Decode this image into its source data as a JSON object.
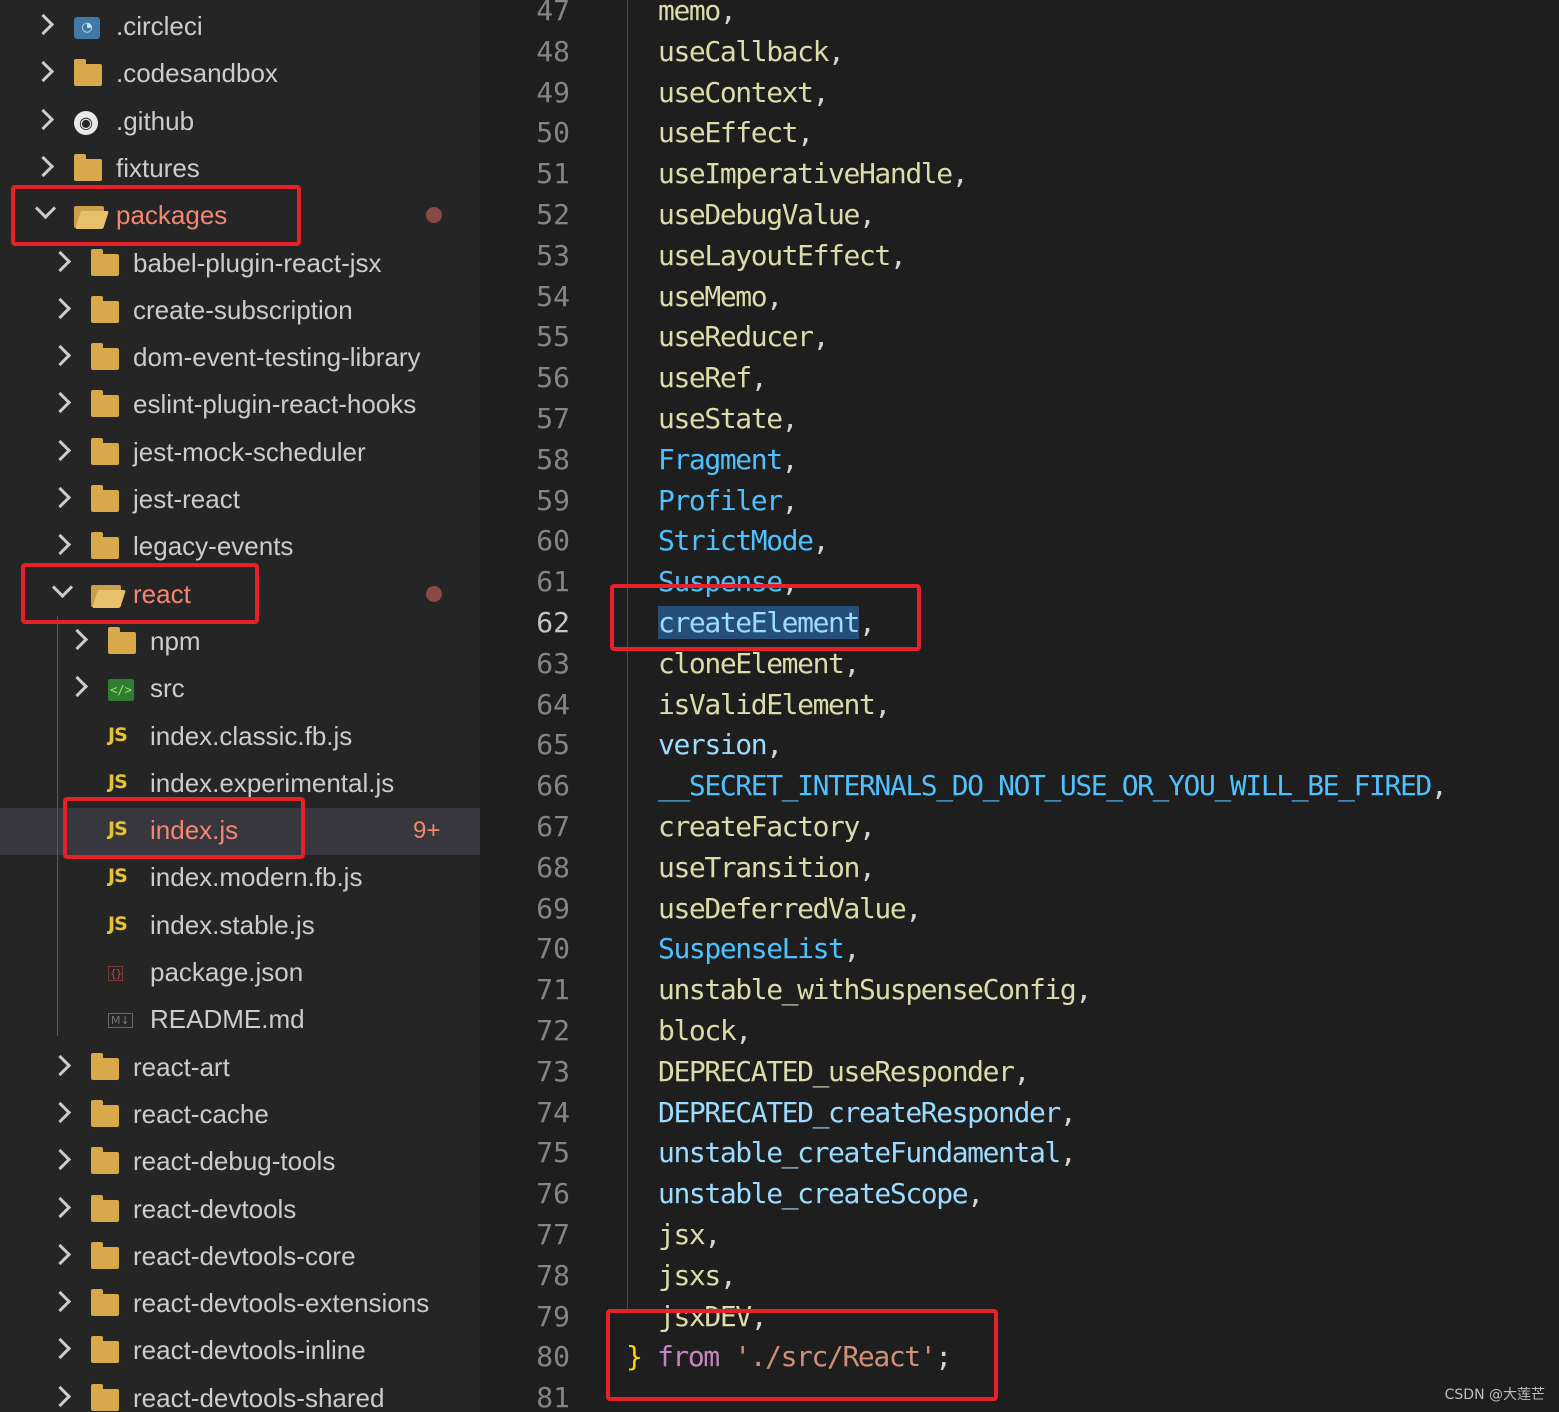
{
  "explorer": {
    "items": [
      {
        "label": ".circleci",
        "icon": "circleci-folder-icon",
        "expanded": false,
        "depth": 0
      },
      {
        "label": ".codesandbox",
        "icon": "folder-icon",
        "expanded": false,
        "depth": 0
      },
      {
        "label": ".github",
        "icon": "github-folder-icon",
        "expanded": false,
        "depth": 0
      },
      {
        "label": "fixtures",
        "icon": "folder-icon",
        "expanded": false,
        "depth": 0
      },
      {
        "label": "packages",
        "icon": "folder-open-icon",
        "expanded": true,
        "depth": 0,
        "modified": true
      },
      {
        "label": "babel-plugin-react-jsx",
        "icon": "folder-icon",
        "expanded": false,
        "depth": 1
      },
      {
        "label": "create-subscription",
        "icon": "folder-icon",
        "expanded": false,
        "depth": 1
      },
      {
        "label": "dom-event-testing-library",
        "icon": "folder-icon",
        "expanded": false,
        "depth": 1
      },
      {
        "label": "eslint-plugin-react-hooks",
        "icon": "folder-icon",
        "expanded": false,
        "depth": 1
      },
      {
        "label": "jest-mock-scheduler",
        "icon": "folder-icon",
        "expanded": false,
        "depth": 1
      },
      {
        "label": "jest-react",
        "icon": "folder-icon",
        "expanded": false,
        "depth": 1
      },
      {
        "label": "legacy-events",
        "icon": "folder-icon",
        "expanded": false,
        "depth": 1
      },
      {
        "label": "react",
        "icon": "folder-open-icon",
        "expanded": true,
        "depth": 1,
        "modified": true
      },
      {
        "label": "npm",
        "icon": "folder-icon",
        "expanded": false,
        "depth": 2
      },
      {
        "label": "src",
        "icon": "src-folder-icon",
        "expanded": false,
        "depth": 2
      },
      {
        "label": "index.classic.fb.js",
        "icon": "js-file-icon",
        "depth": 2
      },
      {
        "label": "index.experimental.js",
        "icon": "js-file-icon",
        "depth": 2
      },
      {
        "label": "index.js",
        "icon": "js-file-icon",
        "depth": 2,
        "selected": true,
        "badge": "9+"
      },
      {
        "label": "index.modern.fb.js",
        "icon": "js-file-icon",
        "depth": 2
      },
      {
        "label": "index.stable.js",
        "icon": "js-file-icon",
        "depth": 2
      },
      {
        "label": "package.json",
        "icon": "json-file-icon",
        "depth": 2
      },
      {
        "label": "README.md",
        "icon": "markdown-file-icon",
        "depth": 2
      },
      {
        "label": "react-art",
        "icon": "folder-icon",
        "expanded": false,
        "depth": 1
      },
      {
        "label": "react-cache",
        "icon": "folder-icon",
        "expanded": false,
        "depth": 1
      },
      {
        "label": "react-debug-tools",
        "icon": "folder-icon",
        "expanded": false,
        "depth": 1
      },
      {
        "label": "react-devtools",
        "icon": "folder-icon",
        "expanded": false,
        "depth": 1
      },
      {
        "label": "react-devtools-core",
        "icon": "folder-icon",
        "expanded": false,
        "depth": 1
      },
      {
        "label": "react-devtools-extensions",
        "icon": "folder-icon",
        "expanded": false,
        "depth": 1
      },
      {
        "label": "react-devtools-inline",
        "icon": "folder-icon",
        "expanded": false,
        "depth": 1
      },
      {
        "label": "react-devtools-shared",
        "icon": "folder-icon",
        "expanded": false,
        "depth": 1
      }
    ],
    "icon_glyphs": {
      "js": "JS",
      "json": "{}",
      "md": "M↓",
      "src": "</>",
      "circleci": "◔",
      "github": "◉"
    }
  },
  "editor": {
    "current_line": "62",
    "lines": [
      {
        "n": "47",
        "parts": [
          [
            "var",
            "memo"
          ],
          [
            "punc",
            ","
          ]
        ]
      },
      {
        "n": "48",
        "parts": [
          [
            "var",
            "useCallback"
          ],
          [
            "punc",
            ","
          ]
        ]
      },
      {
        "n": "49",
        "parts": [
          [
            "var",
            "useContext"
          ],
          [
            "punc",
            ","
          ]
        ]
      },
      {
        "n": "50",
        "parts": [
          [
            "var",
            "useEffect"
          ],
          [
            "punc",
            ","
          ]
        ]
      },
      {
        "n": "51",
        "parts": [
          [
            "var",
            "useImperativeHandle"
          ],
          [
            "punc",
            ","
          ]
        ]
      },
      {
        "n": "52",
        "parts": [
          [
            "var",
            "useDebugValue"
          ],
          [
            "punc",
            ","
          ]
        ]
      },
      {
        "n": "53",
        "parts": [
          [
            "var",
            "useLayoutEffect"
          ],
          [
            "punc",
            ","
          ]
        ]
      },
      {
        "n": "54",
        "parts": [
          [
            "var",
            "useMemo"
          ],
          [
            "punc",
            ","
          ]
        ]
      },
      {
        "n": "55",
        "parts": [
          [
            "var",
            "useReducer"
          ],
          [
            "punc",
            ","
          ]
        ]
      },
      {
        "n": "56",
        "parts": [
          [
            "var",
            "useRef"
          ],
          [
            "punc",
            ","
          ]
        ]
      },
      {
        "n": "57",
        "parts": [
          [
            "var",
            "useState"
          ],
          [
            "punc",
            ","
          ]
        ]
      },
      {
        "n": "58",
        "parts": [
          [
            "const",
            "Fragment"
          ],
          [
            "punc",
            ","
          ]
        ]
      },
      {
        "n": "59",
        "parts": [
          [
            "const",
            "Profiler"
          ],
          [
            "punc",
            ","
          ]
        ]
      },
      {
        "n": "60",
        "parts": [
          [
            "const",
            "StrictMode"
          ],
          [
            "punc",
            ","
          ]
        ]
      },
      {
        "n": "61",
        "parts": [
          [
            "const",
            "Suspense"
          ],
          [
            "punc",
            ","
          ]
        ]
      },
      {
        "n": "62",
        "parts": [
          [
            "sel",
            "createElement"
          ],
          [
            "punc",
            ","
          ]
        ]
      },
      {
        "n": "63",
        "parts": [
          [
            "var",
            "cloneElement"
          ],
          [
            "punc",
            ","
          ]
        ]
      },
      {
        "n": "64",
        "parts": [
          [
            "var",
            "isValidElement"
          ],
          [
            "punc",
            ","
          ]
        ]
      },
      {
        "n": "65",
        "parts": [
          [
            "light",
            "version"
          ],
          [
            "punc",
            ","
          ]
        ]
      },
      {
        "n": "66",
        "parts": [
          [
            "const",
            "__SECRET_INTERNALS_DO_NOT_USE_OR_YOU_WILL_BE_FIRED"
          ],
          [
            "punc",
            ","
          ]
        ]
      },
      {
        "n": "67",
        "parts": [
          [
            "var",
            "createFactory"
          ],
          [
            "punc",
            ","
          ]
        ]
      },
      {
        "n": "68",
        "parts": [
          [
            "var",
            "useTransition"
          ],
          [
            "punc",
            ","
          ]
        ]
      },
      {
        "n": "69",
        "parts": [
          [
            "var",
            "useDeferredValue"
          ],
          [
            "punc",
            ","
          ]
        ]
      },
      {
        "n": "70",
        "parts": [
          [
            "const",
            "SuspenseList"
          ],
          [
            "punc",
            ","
          ]
        ]
      },
      {
        "n": "71",
        "parts": [
          [
            "var",
            "unstable_withSuspenseConfig"
          ],
          [
            "punc",
            ","
          ]
        ]
      },
      {
        "n": "72",
        "parts": [
          [
            "var",
            "block"
          ],
          [
            "punc",
            ","
          ]
        ]
      },
      {
        "n": "73",
        "parts": [
          [
            "var",
            "DEPRECATED_useResponder"
          ],
          [
            "punc",
            ","
          ]
        ]
      },
      {
        "n": "74",
        "parts": [
          [
            "light",
            "DEPRECATED_createResponder"
          ],
          [
            "punc",
            ","
          ]
        ]
      },
      {
        "n": "75",
        "parts": [
          [
            "light",
            "unstable_createFundamental"
          ],
          [
            "punc",
            ","
          ]
        ]
      },
      {
        "n": "76",
        "parts": [
          [
            "light",
            "unstable_createScope"
          ],
          [
            "punc",
            ","
          ]
        ]
      },
      {
        "n": "77",
        "parts": [
          [
            "var",
            "jsx"
          ],
          [
            "punc",
            ","
          ]
        ]
      },
      {
        "n": "78",
        "parts": [
          [
            "var",
            "jsxs"
          ],
          [
            "punc",
            ","
          ]
        ]
      },
      {
        "n": "79",
        "parts": [
          [
            "var",
            "jsxDEV"
          ],
          [
            "punc",
            ","
          ]
        ]
      },
      {
        "n": "80",
        "parts": [
          [
            "punc-brace",
            "}"
          ],
          [
            "punc",
            " "
          ],
          [
            "kw",
            "from"
          ],
          [
            "punc",
            " "
          ],
          [
            "str",
            "'./src/React'"
          ],
          [
            "punc",
            ";"
          ]
        ]
      },
      {
        "n": "81",
        "parts": []
      }
    ]
  },
  "colors": {
    "highlight_box": "#e8202a",
    "keyword": "#c586c0",
    "string": "#ce9178",
    "function": "#dcdcaa",
    "constant": "#4fc1ff",
    "selection": "#264f78"
  },
  "watermark": "CSDN @大莲芒"
}
